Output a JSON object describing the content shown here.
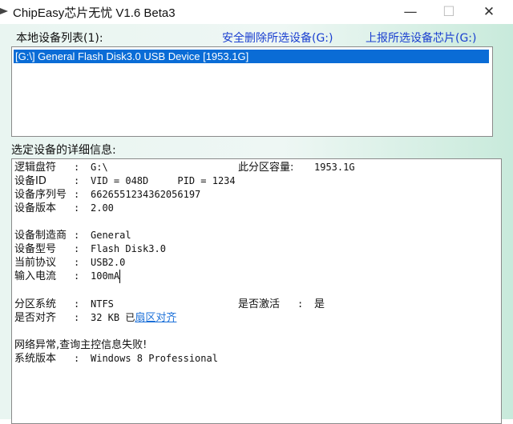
{
  "window": {
    "title": "ChipEasy芯片无忧 V1.6 Beta3",
    "minimize": "—",
    "maximize": "☐",
    "close": "✕"
  },
  "devices": {
    "label": "本地设备列表(1):",
    "safe_remove": "安全删除所选设备(G:)",
    "report": "上报所选设备芯片(G:)",
    "items": [
      "[G:\\] General Flash Disk3.0 USB Device [1953.1G]"
    ]
  },
  "details": {
    "label": "选定设备的详细信息:",
    "sep": ":",
    "rows": [
      {
        "k": "逻辑盘符",
        "v": "G:\\"
      },
      {
        "k": "设备ID",
        "v": "VID = 048D     PID = 1234"
      },
      {
        "k": "设备序列号",
        "v": "6626551234362056197"
      },
      {
        "k": "设备版本",
        "v": "2.00"
      },
      {
        "k": "设备制造商",
        "v": "General"
      },
      {
        "k": "设备型号",
        "v": "Flash Disk3.0"
      },
      {
        "k": "当前协议",
        "v": "USB2.0"
      },
      {
        "k": "输入电流",
        "v": "100mA"
      },
      {
        "k": "分区系统",
        "v": "NTFS"
      },
      {
        "k": "是否对齐",
        "v": "32 KB 已",
        "link": "扇区对齐"
      },
      {
        "k": "系统版本",
        "v": "Windows 8 Professional"
      }
    ],
    "capacity_label": "此分区容量:",
    "capacity": "1953.1G",
    "active_label": "是否激活",
    "active": "是",
    "network_error": "网络异常,查询主控信息失败!"
  }
}
